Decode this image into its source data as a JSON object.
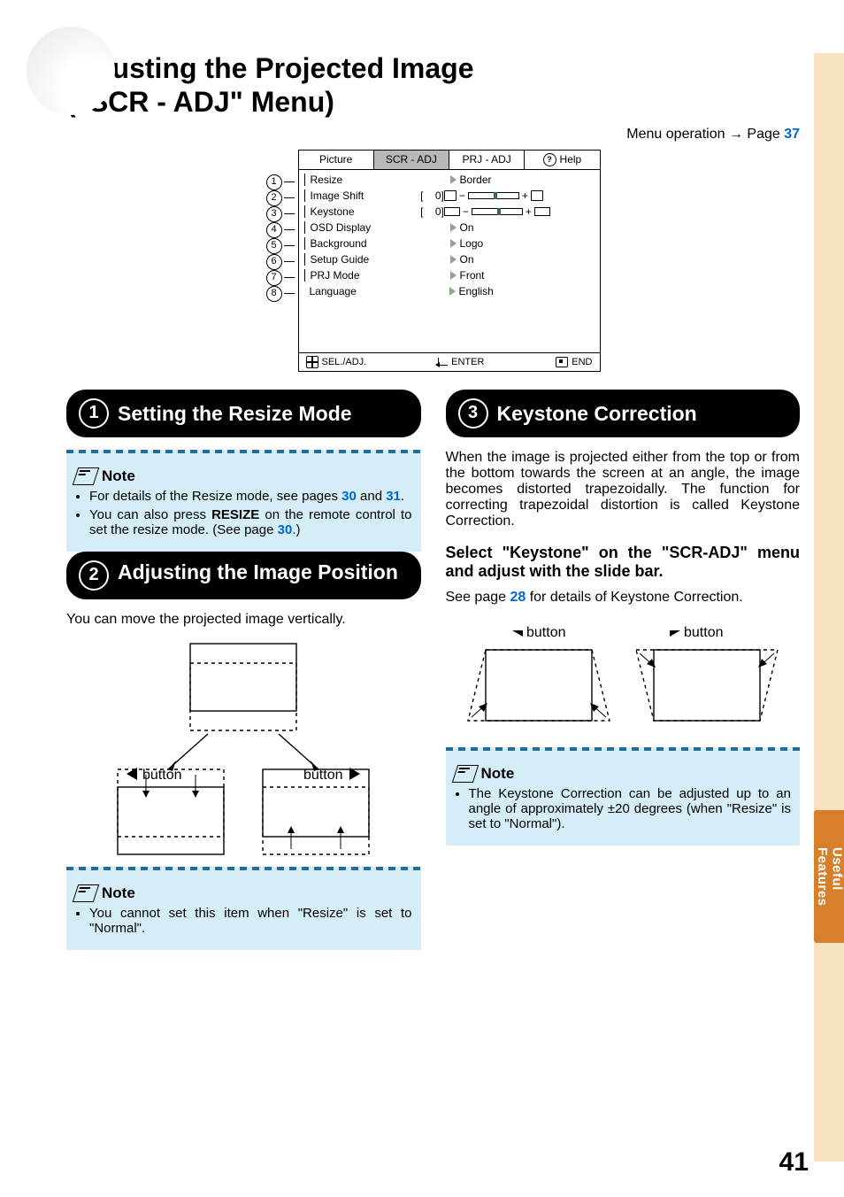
{
  "title_line1": "Adjusting the Projected Image",
  "title_line2": "(\"SCR - ADJ\" Menu)",
  "menu_operation_prefix": "Menu operation ",
  "menu_operation_link_label": "Page ",
  "menu_operation_page": "37",
  "osd": {
    "tabs": {
      "picture": "Picture",
      "scr_adj": "SCR - ADJ",
      "prj_adj": "PRJ - ADJ",
      "help": "Help"
    },
    "rows": [
      {
        "num": "1",
        "label": "Resize",
        "value": "Border"
      },
      {
        "num": "2",
        "label": "Image Shift",
        "slider": "0"
      },
      {
        "num": "3",
        "label": "Keystone",
        "slider": "0"
      },
      {
        "num": "4",
        "label": "OSD Display",
        "value": "On"
      },
      {
        "num": "5",
        "label": "Background",
        "value": "Logo"
      },
      {
        "num": "6",
        "label": "Setup Guide",
        "value": "On"
      },
      {
        "num": "7",
        "label": "PRJ Mode",
        "value": "Front"
      },
      {
        "num": "8",
        "label": "Language",
        "value": "English"
      }
    ],
    "foot": {
      "sel": "SEL./ADJ.",
      "enter": "ENTER",
      "end": "END"
    }
  },
  "sections": {
    "s1": {
      "num": "1",
      "title": "Setting the Resize Mode"
    },
    "s2": {
      "num": "2",
      "title": "Adjusting the Image Position"
    },
    "s3": {
      "num": "3",
      "title": "Keystone Correction"
    }
  },
  "note_label": "Note",
  "notes": {
    "n1_a_pre": "For details of the Resize mode, see pages ",
    "n1_a_p1": "30",
    "n1_a_mid": " and ",
    "n1_a_p2": "31",
    "n1_a_post": ".",
    "n1_b_pre": "You can also press ",
    "n1_b_bold": "RESIZE",
    "n1_b_mid": " on the remote control to set the resize mode. (See page ",
    "n1_b_page": "30",
    "n1_b_post": ".)",
    "n2": "You cannot set this item when \"Resize\" is set to \"Normal\".",
    "n3": "The Keystone Correction can be adjusted up to an angle of approximately ±20 degrees (when \"Resize\" is set to \"Normal\")."
  },
  "body": {
    "s2_intro": "You can move the projected image vertically.",
    "s3_intro": "When the image is projected either from the top or from the bottom towards the screen at an angle, the image becomes distorted trapezoidally. The function for correcting trapezoidal distortion is called Keystone Correction.",
    "s3_sub": "Select \"Keystone\" on the \"SCR-ADJ\" menu and adjust with the slide bar.",
    "s3_seepage_pre": "See page ",
    "s3_seepage_page": "28",
    "s3_seepage_post": " for details of Keystone Correction."
  },
  "button_label": "button",
  "side_tab_line1": "Useful",
  "side_tab_line2": "Features",
  "page_number": "41"
}
